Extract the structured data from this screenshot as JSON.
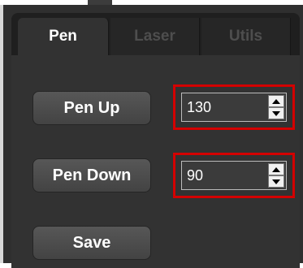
{
  "tabs": [
    {
      "label": "Pen",
      "active": true
    },
    {
      "label": "Laser",
      "active": false
    },
    {
      "label": "Utils",
      "active": false
    }
  ],
  "pen": {
    "pen_up_label": "Pen Up",
    "pen_up_value": "130",
    "pen_down_label": "Pen Down",
    "pen_down_value": "90",
    "save_label": "Save"
  },
  "colors": {
    "panel": "#2f2f2f",
    "tabbar": "#1f1f1f",
    "highlight": "#d40000",
    "active_tab_text": "#ffffff",
    "inactive_tab_text": "#4e4e4e"
  },
  "icons": {
    "spinner_up": "triangle-up-icon",
    "spinner_down": "triangle-down-icon"
  }
}
